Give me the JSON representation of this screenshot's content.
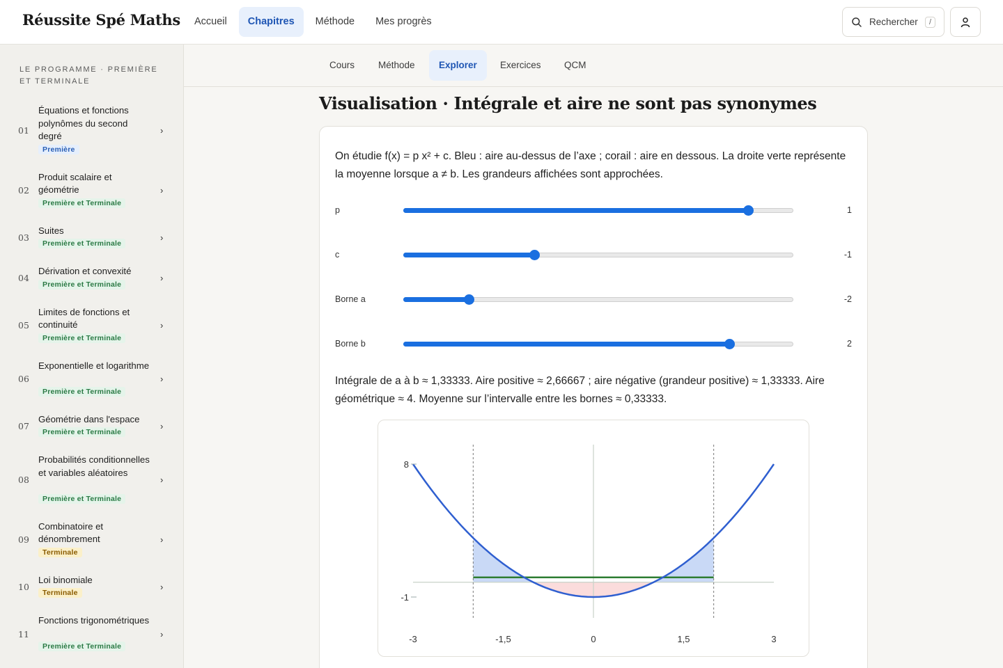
{
  "brand": "Réussite Spé Maths",
  "nav": [
    "Accueil",
    "Chapitres",
    "Méthode",
    "Mes progrès"
  ],
  "nav_active": "Chapitres",
  "search": {
    "label": "Rechercher",
    "shortcut": "/"
  },
  "sidebar": {
    "heading": "Le programme · Première et Terminale",
    "chapters": [
      {
        "num": "01",
        "title": "Équations et fonctions polynômes du second degré",
        "tag": "Première",
        "tag_kind": "premiere"
      },
      {
        "num": "02",
        "title": "Produit scalaire et géométrie",
        "tag": "Première et Terminale",
        "tag_kind": "both"
      },
      {
        "num": "03",
        "title": "Suites",
        "tag": "Première et Terminale",
        "tag_kind": "both"
      },
      {
        "num": "04",
        "title": "Dérivation et convexité",
        "tag": "Première et Terminale",
        "tag_kind": "both"
      },
      {
        "num": "05",
        "title": "Limites de fonctions et continuité",
        "tag": "Première et Terminale",
        "tag_kind": "both"
      },
      {
        "num": "06",
        "title": "Exponentielle et logarithme",
        "tag": "Première et Terminale",
        "tag_kind": "both"
      },
      {
        "num": "07",
        "title": "Géométrie dans l'espace",
        "tag": "Première et Terminale",
        "tag_kind": "both"
      },
      {
        "num": "08",
        "title": "Probabilités conditionnelles et variables aléatoires",
        "tag": "Première et Terminale",
        "tag_kind": "both"
      },
      {
        "num": "09",
        "title": "Combinatoire et dénombrement",
        "tag": "Terminale",
        "tag_kind": "terminale"
      },
      {
        "num": "10",
        "title": "Loi binomiale",
        "tag": "Terminale",
        "tag_kind": "terminale"
      },
      {
        "num": "11",
        "title": "Fonctions trigonométriques",
        "tag": "Première et Terminale",
        "tag_kind": "both"
      }
    ]
  },
  "subtabs": [
    "Cours",
    "Méthode",
    "Explorer",
    "Exercices",
    "QCM"
  ],
  "subtab_active": "Explorer",
  "page_title": "Visualisation · Intégrale et aire ne sont pas synonymes",
  "intro": "On étudie f(x) = p x² + c. Bleu : aire au-dessus de l’axe ; corail : aire en dessous. La droite verte représente la moyenne lorsque a ≠ b. Les grandeurs affichées sont approchées.",
  "sliders": [
    {
      "label": "p",
      "value": 1,
      "display": "1",
      "min": -2,
      "max": 1.4
    },
    {
      "label": "c",
      "value": -1,
      "display": "-1",
      "min": -3,
      "max": 3
    },
    {
      "label": "Borne a",
      "value": -2,
      "display": "-2",
      "min": -3,
      "max": 3
    },
    {
      "label": "Borne b",
      "value": 2,
      "display": "2",
      "min": -3,
      "max": 3
    }
  ],
  "result": "Intégrale de a à b ≈ 1,33333. Aire positive ≈ 2,66667 ; aire négative (grandeur positive) ≈ 1,33333. Aire géométrique ≈ 4. Moyenne sur l’intervalle entre les bornes ≈ 0,33333.",
  "chart_data": {
    "type": "line",
    "function": "f(x) = x² - 1",
    "p": 1,
    "c": -1,
    "x_range": [
      -3,
      3
    ],
    "y_range": [
      -1,
      8
    ],
    "x_ticks": [
      "-3",
      "-1,5",
      "0",
      "1,5",
      "3"
    ],
    "x_tick_values": [
      -3,
      -1.5,
      0,
      1.5,
      3
    ],
    "y_ticks": [
      "8",
      "-1"
    ],
    "y_tick_values": [
      8,
      -1
    ],
    "bounds": [
      -2,
      2
    ],
    "mean": 0.33333,
    "colors": {
      "curve": "#2f5fd0",
      "positive": "#c9d9f6",
      "negative": "#fbdcdc",
      "mean": "#2e7d32",
      "axis": "#c8d3c8"
    }
  }
}
